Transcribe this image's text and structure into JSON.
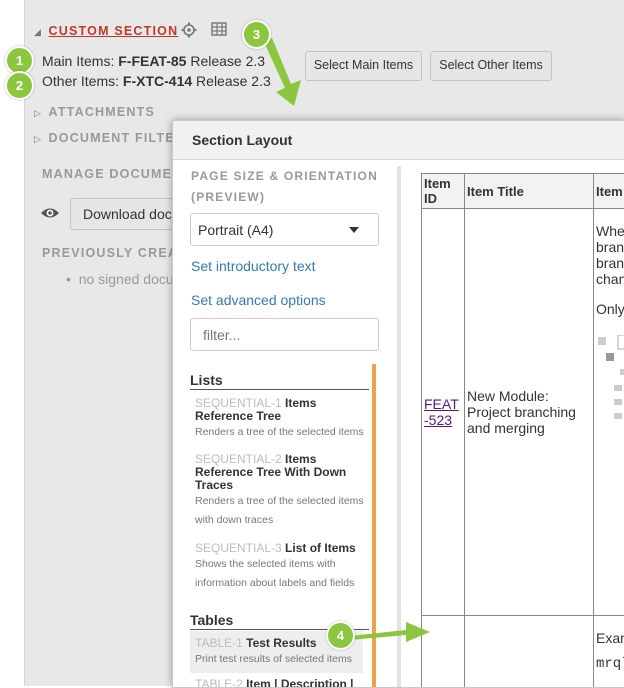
{
  "section": {
    "title": "CUSTOM SECTION",
    "main_items_label": "Main Items:",
    "main_items_id": "F-FEAT-85",
    "main_items_release": "Release 2.3",
    "other_items_label": "Other Items:",
    "other_items_id": "F-XTC-414",
    "other_items_release": "Release 2.3",
    "select_main_label": "Select Main Items",
    "select_other_label": "Select Other Items"
  },
  "sidebar_sections": {
    "attachments": "ATTACHMENTS",
    "document_filter": "DOCUMENT FILTER",
    "manage_documents": "MANAGE DOCUMEN",
    "download_label": "Download doc",
    "previously_created": "PREVIOUSLY CREA",
    "no_signed": "no signed docu"
  },
  "badges": [
    "1",
    "2",
    "3",
    "4"
  ],
  "modal": {
    "title": "Section Layout",
    "page_size_heading": "PAGE SIZE & ORIENTATION (PREVIEW)",
    "page_size_value": "Portrait (A4)",
    "intro_link": "Set introductory text",
    "advanced_link": "Set advanced options",
    "filter_placeholder": "filter...",
    "lists_heading": "Lists",
    "list_items": [
      {
        "code": "SEQUENTIAL-1",
        "name": "Items Reference Tree",
        "desc": "Renders a tree of the selected items"
      },
      {
        "code": "SEQUENTIAL-2",
        "name": "Items Reference Tree With Down Traces",
        "desc": "Renders a tree of the selected items with down traces"
      },
      {
        "code": "SEQUENTIAL-3",
        "name": "List of Items",
        "desc": "Shows the selected items with information about labels and fields"
      }
    ],
    "tables_heading": "Tables",
    "table_items": [
      {
        "code": "TABLE-1",
        "name": "Test Results",
        "desc": "Print test results of selected items"
      },
      {
        "code": "TABLE-2",
        "name": "Item | Description |"
      }
    ]
  },
  "preview": {
    "headers": [
      "Item ID",
      "Item Title",
      "Item"
    ],
    "row1": {
      "id_link": "FEAT-523",
      "title": "New Module: Project branching and merging",
      "desc_lines": [
        "Whe",
        "branc",
        "branc",
        "chan",
        "Only"
      ]
    },
    "row2": {
      "desc_line1": "Exam",
      "desc_line2": "mrql"
    }
  },
  "colors": {
    "accent_red": "#c0392b",
    "badge_green": "#8cc63f",
    "link_blue": "#337ab7",
    "orange_bar": "#f0a04b"
  },
  "icons": [
    "gear-icon",
    "table-icon",
    "eye-icon",
    "caret-down-icon",
    "arrow-icon"
  ]
}
